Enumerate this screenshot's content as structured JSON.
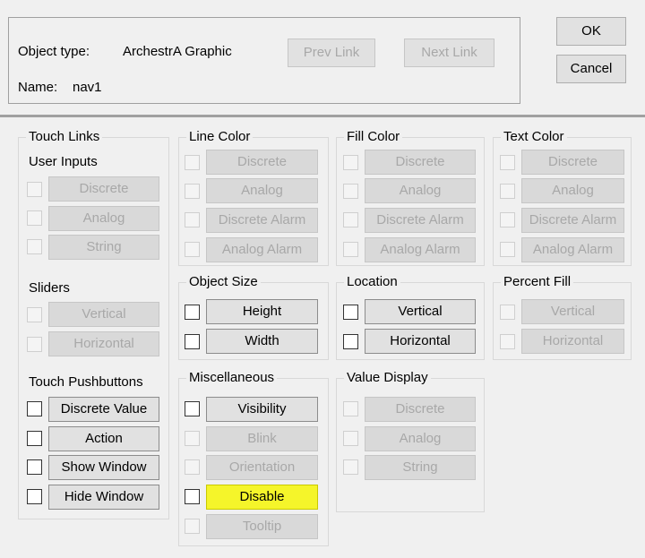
{
  "header": {
    "object_type_label": "Object type:",
    "object_type_value": "ArchestrA Graphic",
    "name_label": "Name:",
    "name_value": "nav1",
    "prev_link": "Prev Link",
    "next_link": "Next Link",
    "ok": "OK",
    "cancel": "Cancel"
  },
  "touch_links": {
    "title": "Touch Links",
    "user_inputs": {
      "title": "User Inputs",
      "items": [
        "Discrete",
        "Analog",
        "String"
      ]
    },
    "sliders": {
      "title": "Sliders",
      "items": [
        "Vertical",
        "Horizontal"
      ]
    },
    "pushbuttons": {
      "title": "Touch Pushbuttons",
      "items": [
        "Discrete Value",
        "Action",
        "Show Window",
        "Hide Window"
      ]
    }
  },
  "line_color": {
    "title": "Line Color",
    "items": [
      "Discrete",
      "Analog",
      "Discrete Alarm",
      "Analog Alarm"
    ]
  },
  "fill_color": {
    "title": "Fill Color",
    "items": [
      "Discrete",
      "Analog",
      "Discrete Alarm",
      "Analog Alarm"
    ]
  },
  "text_color": {
    "title": "Text Color",
    "items": [
      "Discrete",
      "Analog",
      "Discrete Alarm",
      "Analog Alarm"
    ]
  },
  "object_size": {
    "title": "Object Size",
    "items": [
      "Height",
      "Width"
    ]
  },
  "location": {
    "title": "Location",
    "items": [
      "Vertical",
      "Horizontal"
    ]
  },
  "percent_fill": {
    "title": "Percent Fill",
    "items": [
      "Vertical",
      "Horizontal"
    ]
  },
  "miscellaneous": {
    "title": "Miscellaneous",
    "items": [
      "Visibility",
      "Blink",
      "Orientation",
      "Disable",
      "Tooltip"
    ]
  },
  "value_display": {
    "title": "Value Display",
    "items": [
      "Discrete",
      "Analog",
      "String"
    ]
  },
  "colors": {
    "dialog_bg": "#f0f0f0",
    "highlight": "#f5f52a",
    "disabled_text": "#a8a8a8"
  }
}
